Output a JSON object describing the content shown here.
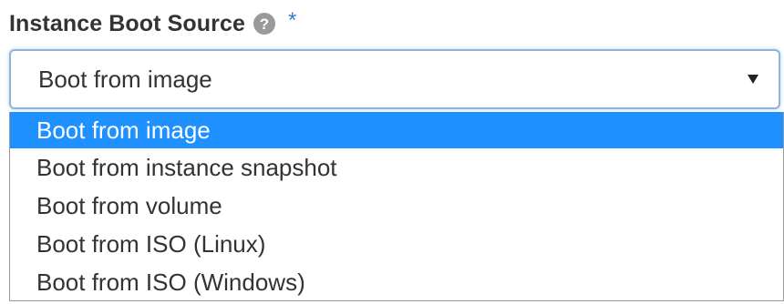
{
  "field": {
    "label": "Instance Boot Source",
    "help_icon": "question-circle-icon",
    "required_marker": "*"
  },
  "select": {
    "value": "Boot from image",
    "caret_icon": "caret-down-icon"
  },
  "dropdown": {
    "options": [
      {
        "label": "Boot from image",
        "selected": true
      },
      {
        "label": "Boot from instance snapshot",
        "selected": false
      },
      {
        "label": "Boot from volume",
        "selected": false
      },
      {
        "label": "Boot from ISO (Linux)",
        "selected": false
      },
      {
        "label": "Boot from ISO (Windows)",
        "selected": false
      }
    ]
  },
  "colors": {
    "label_text": "#333333",
    "required_star": "#3a7ec8",
    "selected_option_bg": "#1e90ff",
    "selected_option_text": "#ffffff",
    "focus_border": "#8fb3d9"
  }
}
